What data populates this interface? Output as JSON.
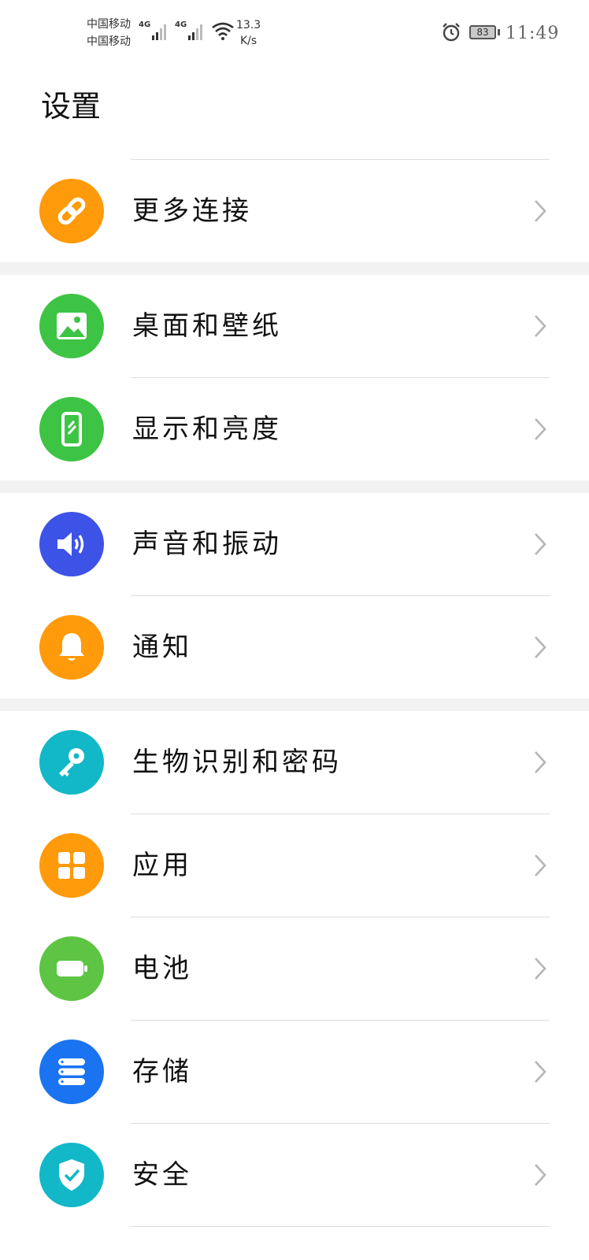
{
  "status_bar": {
    "carrier1": "中国移动",
    "carrier2": "中国移动",
    "net1": "4G",
    "net2": "4G",
    "speed_value": "13.3",
    "speed_unit": "K/s",
    "battery_level": "83",
    "time": "11:49"
  },
  "page": {
    "title": "设置"
  },
  "items": [
    {
      "label": "更多连接",
      "icon": "link-icon",
      "color": "#ff9a0a"
    },
    {
      "label": "桌面和壁纸",
      "icon": "image-icon",
      "color": "#3dc444"
    },
    {
      "label": "显示和亮度",
      "icon": "phone-brightness-icon",
      "color": "#3dc444"
    },
    {
      "label": "声音和振动",
      "icon": "speaker-icon",
      "color": "#3d52e6"
    },
    {
      "label": "通知",
      "icon": "bell-icon",
      "color": "#ff9a0a"
    },
    {
      "label": "生物识别和密码",
      "icon": "key-icon",
      "color": "#12b8c7"
    },
    {
      "label": "应用",
      "icon": "apps-grid-icon",
      "color": "#ff9a0a"
    },
    {
      "label": "电池",
      "icon": "battery-icon",
      "color": "#5dc444"
    },
    {
      "label": "存储",
      "icon": "storage-icon",
      "color": "#1a73f0"
    },
    {
      "label": "安全",
      "icon": "shield-icon",
      "color": "#12b8c7"
    }
  ],
  "colors": {
    "chevron": "#b5b5b5",
    "divider": "#dedede",
    "section_gap": "#f2f2f2"
  }
}
